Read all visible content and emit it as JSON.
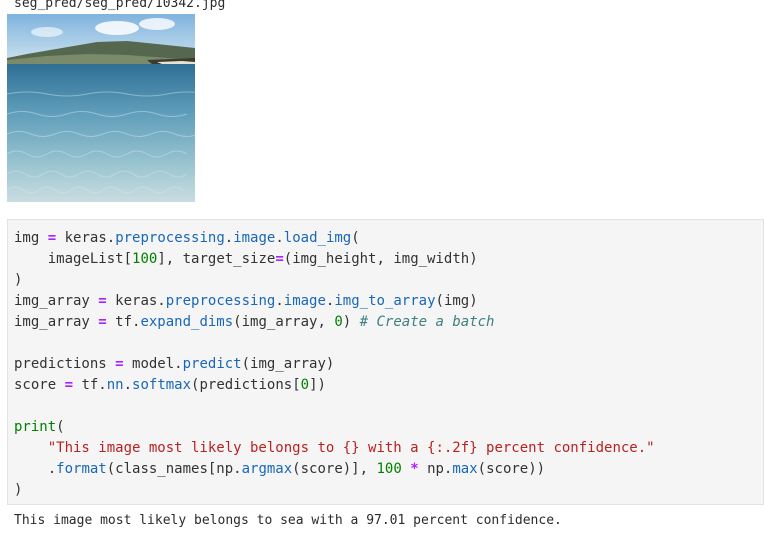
{
  "output_path": "seg_pred/seg_pred/10342.jpg",
  "image": {
    "description_icon": "sea-photo",
    "colors": {
      "sky": "#9cc6e3",
      "hills": "#5a6b55",
      "sea_top": "#3c7ea0",
      "sea_bottom": "#bfd9df"
    }
  },
  "code": {
    "l1": {
      "a": "img",
      "b": " ",
      "c": "=",
      "d": " keras.",
      "e": "preprocessing",
      "f": ".",
      "g": "image",
      "h": ".",
      "i": "load_img",
      "j": "("
    },
    "l2": {
      "a": "    imageList[",
      "b": "100",
      "c": "], target_size",
      "d": "=",
      "e": "(img_height, img_width)"
    },
    "l3": {
      "a": ")"
    },
    "l4": {
      "a": "img_array ",
      "b": "=",
      "c": " keras.",
      "d": "preprocessing",
      "e": ".",
      "f": "image",
      "g": ".",
      "h": "img_to_array",
      "i": "(img)"
    },
    "l5": {
      "a": "img_array ",
      "b": "=",
      "c": " tf.",
      "d": "expand_dims",
      "e": "(img_array, ",
      "f": "0",
      "g": ") ",
      "h": "# Create a batch"
    },
    "l7": {
      "a": "predictions ",
      "b": "=",
      "c": " model.",
      "d": "predict",
      "e": "(img_array)"
    },
    "l8": {
      "a": "score ",
      "b": "=",
      "c": " tf.",
      "d": "nn",
      "e": ".",
      "f": "softmax",
      "g": "(predictions[",
      "h": "0",
      "i": "])"
    },
    "l10": {
      "a": "print",
      "b": "("
    },
    "l11": {
      "a": "    ",
      "b": "\"This image most likely belongs to {} with a {:.2f} percent confidence.\""
    },
    "l12": {
      "a": "    .",
      "b": "format",
      "c": "(class_names[np.",
      "d": "argmax",
      "e": "(score)], ",
      "f": "100",
      "g": " ",
      "h": "*",
      "i": " np.",
      "j": "max",
      "k": "(score))"
    },
    "l13": {
      "a": ")"
    }
  },
  "result_text": "This image most likely belongs to sea with a 97.01 percent confidence."
}
